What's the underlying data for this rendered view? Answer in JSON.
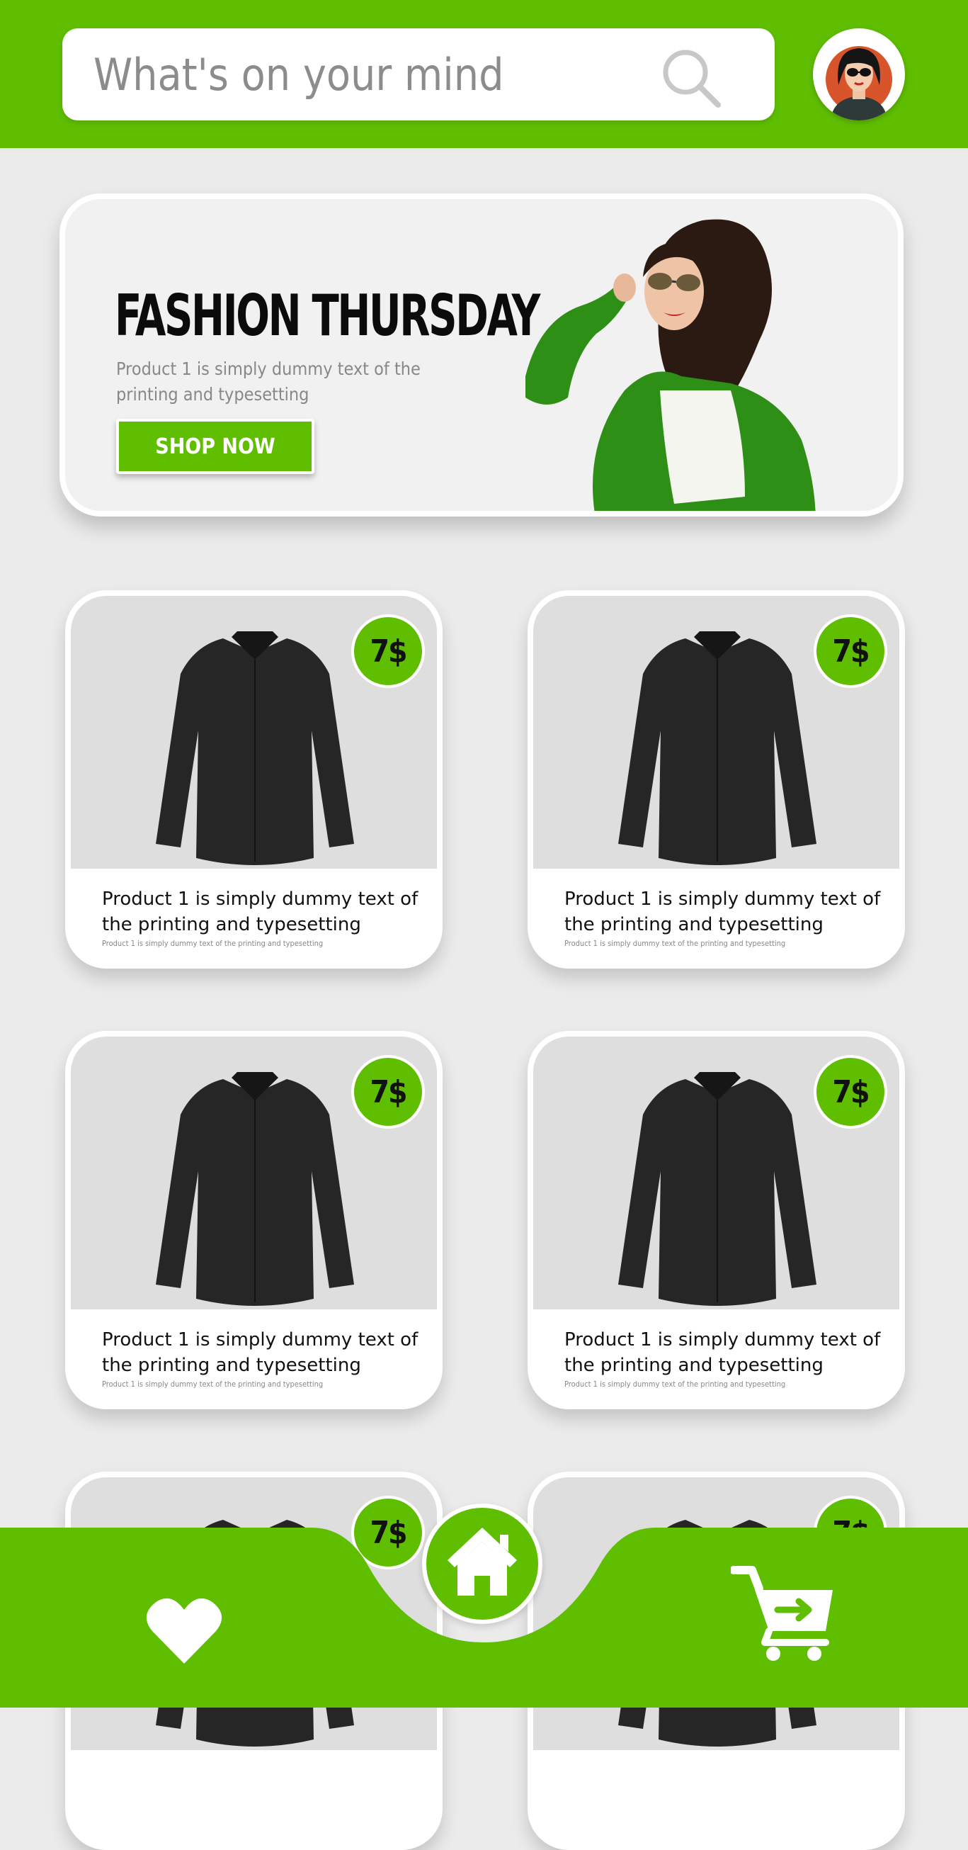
{
  "search": {
    "placeholder": "What's on your mind"
  },
  "icons": {
    "search": "search-icon",
    "avatar": "avatar",
    "heart": "heart-icon",
    "home": "home-icon",
    "cart": "cart-icon"
  },
  "colors": {
    "accent": "#5fbe00",
    "background": "#ebebeb",
    "white": "#ffffff"
  },
  "banner": {
    "title": "FASHION THURSDAY",
    "description": "Product 1 is simply dummy text of the printing and typesetting",
    "button_label": "SHOP NOW"
  },
  "products": [
    {
      "price": "7$",
      "title": "Product 1 is simply dummy text of the printing and typesetting",
      "subtitle": "Product 1 is simply dummy text of the printing and typesetting"
    },
    {
      "price": "7$",
      "title": "Product 1 is simply dummy text of the printing and typesetting",
      "subtitle": "Product 1 is simply dummy text of the printing and typesetting"
    },
    {
      "price": "7$",
      "title": "Product 1 is simply dummy text of the printing and typesetting",
      "subtitle": "Product 1 is simply dummy text of the printing and typesetting"
    },
    {
      "price": "7$",
      "title": "Product 1 is simply dummy text of the printing and typesetting",
      "subtitle": "Product 1 is simply dummy text of the printing and typesetting"
    },
    {
      "price": "7$"
    },
    {
      "price": "7$"
    }
  ]
}
